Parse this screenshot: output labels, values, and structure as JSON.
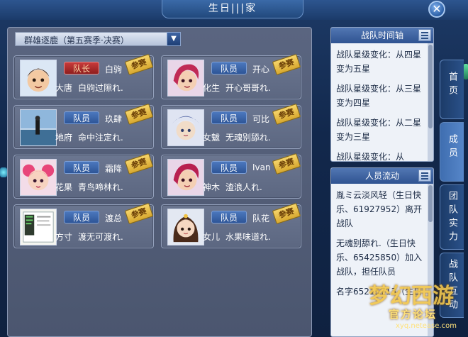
{
  "window": {
    "title": "生日|||家",
    "close_symbol": "✕"
  },
  "season": {
    "selected": "群雄逐鹿（第五赛季·决赛）",
    "dropdown_symbol": "▼"
  },
  "members": [
    {
      "role": "队长",
      "name": "白驹",
      "school": "大唐",
      "nick": "白驹过隙れ.",
      "stamp": "参赛",
      "leader": true
    },
    {
      "role": "队员",
      "name": "开心",
      "school": "化生",
      "nick": "开心哥哥れ.",
      "stamp": "参赛"
    },
    {
      "role": "队员",
      "name": "玖肆",
      "school": "地府",
      "nick": "命中注定れ.",
      "stamp": "参赛"
    },
    {
      "role": "队员",
      "name": "可比",
      "school": "女魃",
      "nick": "无魂别舔れ.",
      "stamp": "参赛"
    },
    {
      "role": "队员",
      "name": "霜降",
      "school": "花果",
      "nick": "青鸟啼林れ.",
      "stamp": "参赛"
    },
    {
      "role": "队员",
      "name": "Ivan",
      "school": "神木",
      "nick": "渣浪人れ.",
      "stamp": "参赛"
    },
    {
      "role": "队员",
      "name": "渡总",
      "school": "方寸",
      "nick": "渡无可渡れ.",
      "stamp": "参赛"
    },
    {
      "role": "队员",
      "name": "队花",
      "school": "女儿",
      "nick": "水果味道れ.",
      "stamp": "参赛"
    }
  ],
  "timeline": {
    "title": "战队时间轴",
    "entries": [
      "战队星级变化：从四星变为五星",
      "战队星级变化：从三星变为四星",
      "战队星级变化：从二星变为三星",
      "战队星级变化：从"
    ]
  },
  "flow": {
    "title": "人员流动",
    "entries": [
      "胤ミ云淡风轻（生日快乐、61927952）离开战队",
      "无魂别舔れ.（生日快乐、65425850）加入战队，担任队员",
      "名字65215713（生日"
    ]
  },
  "tabs": [
    "首页",
    "成员",
    "团队实力",
    "战队互动"
  ],
  "watermark": {
    "logo": "梦幻西游",
    "sub": "官方论坛",
    "url": "xyq.netease.com"
  }
}
